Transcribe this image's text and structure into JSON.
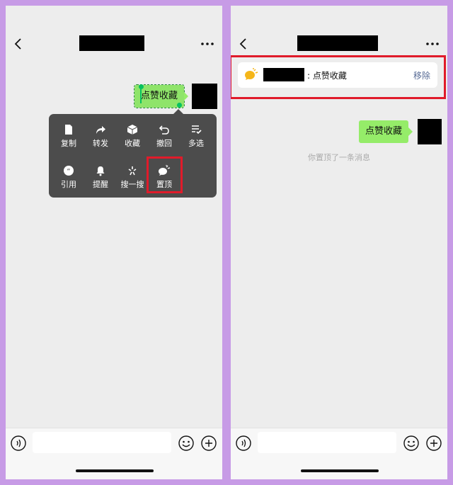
{
  "left": {
    "message": "点赞收藏",
    "menu": {
      "row1": [
        "复制",
        "转发",
        "收藏",
        "撤回",
        "多选"
      ],
      "row2": [
        "引用",
        "提醒",
        "搜一搜",
        "置顶"
      ]
    }
  },
  "right": {
    "pinned": {
      "text": ": 点赞收藏",
      "remove_label": "移除"
    },
    "message": "点赞收藏",
    "system_notice": "你置顶了一条消息"
  },
  "icons": {
    "back": "chevron-left-icon",
    "more": "more-icon",
    "voice": "voice-icon",
    "emoji": "emoji-icon",
    "plus": "plus-icon",
    "pin": "pin-bubble-icon"
  },
  "colors": {
    "bubble": "#95ec69",
    "highlight": "#e01b2a",
    "remove_link": "#576b95",
    "selection": "#07c160",
    "pin_icon": "#f5b619"
  }
}
